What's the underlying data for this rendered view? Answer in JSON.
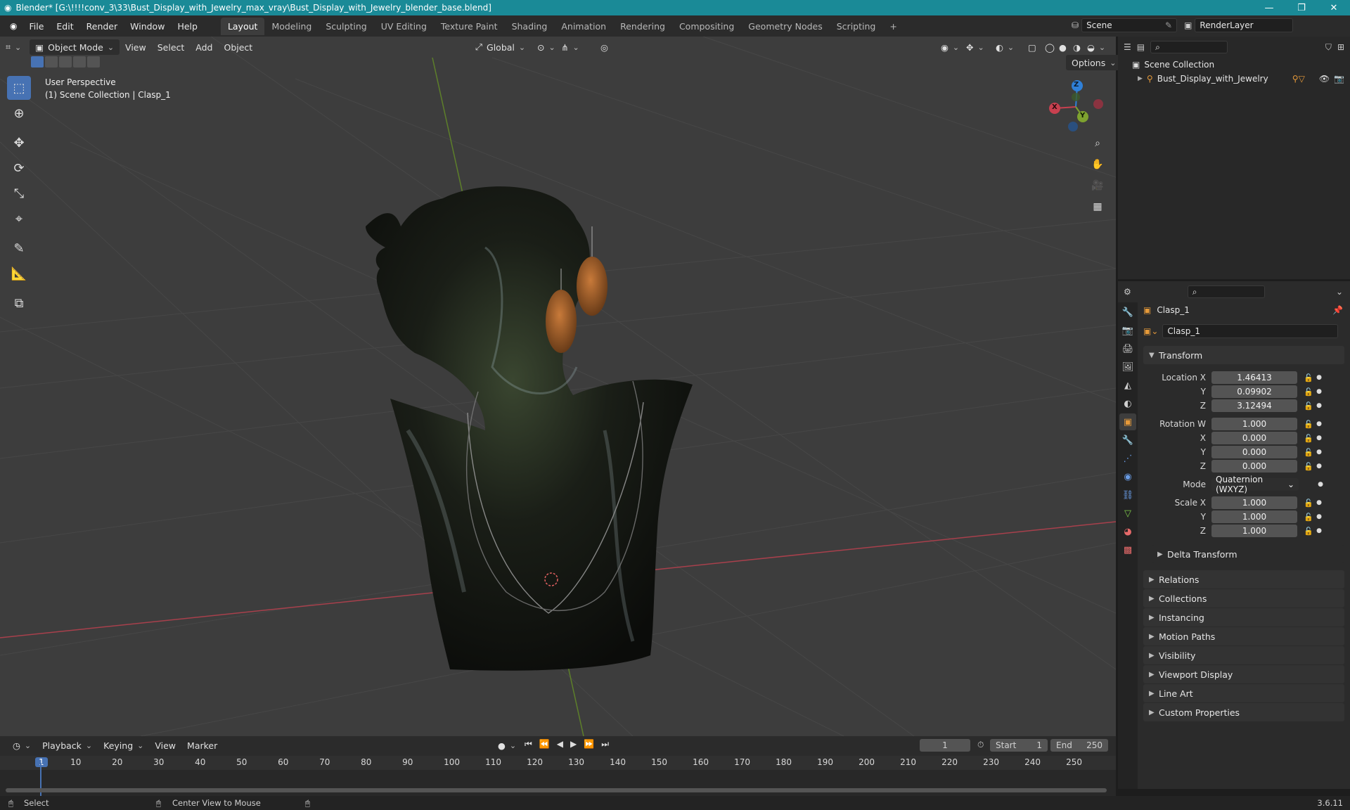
{
  "window": {
    "title": "Blender* [G:\\!!!!conv_3\\33\\Bust_Display_with_Jewelry_max_vray\\Bust_Display_with_Jewelry_blender_base.blend]",
    "minimize": "—",
    "maximize": "❐",
    "close": "✕"
  },
  "menubar": {
    "menus": [
      "File",
      "Edit",
      "Render",
      "Window",
      "Help"
    ],
    "workspaces": [
      "Layout",
      "Modeling",
      "Sculpting",
      "UV Editing",
      "Texture Paint",
      "Shading",
      "Animation",
      "Rendering",
      "Compositing",
      "Geometry Nodes",
      "Scripting"
    ],
    "add_workspace": "+",
    "scene": "Scene",
    "view_layer": "RenderLayer"
  },
  "viewport": {
    "mode": "Object Mode",
    "menus": [
      "View",
      "Select",
      "Add",
      "Object"
    ],
    "transform_orientation": "Global",
    "options": "Options",
    "overlay_title": "User Perspective",
    "overlay_sub": "(1) Scene Collection | Clasp_1",
    "gizmo_axes": {
      "x": "X",
      "y": "Y",
      "z": "Z"
    },
    "colors": {
      "x_axis": "#c8404f",
      "y_axis": "#7ea22f",
      "z_axis": "#2f80d8",
      "grid": "#484848",
      "bg": "#3d3d3d"
    }
  },
  "outliner": {
    "root": "Scene Collection",
    "items": [
      {
        "label": "Bust_Display_with_Jewelry"
      }
    ]
  },
  "properties": {
    "object_name": "Clasp_1",
    "data_name": "Clasp_1",
    "transform_title": "Transform",
    "location": {
      "label_x": "Location X",
      "label_y": "Y",
      "label_z": "Z",
      "x": "1.46413",
      "y": "0.09902",
      "z": "3.12494"
    },
    "rotation": {
      "label_w": "Rotation W",
      "label_x": "X",
      "label_y": "Y",
      "label_z": "Z",
      "w": "1.000",
      "x": "0.000",
      "y": "0.000",
      "z": "0.000"
    },
    "mode_label": "Mode",
    "mode_value": "Quaternion (WXYZ)",
    "scale": {
      "label_x": "Scale X",
      "label_y": "Y",
      "label_z": "Z",
      "x": "1.000",
      "y": "1.000",
      "z": "1.000"
    },
    "delta_transform": "Delta Transform",
    "panels": [
      "Relations",
      "Collections",
      "Instancing",
      "Motion Paths",
      "Visibility",
      "Viewport Display",
      "Line Art",
      "Custom Properties"
    ]
  },
  "timeline": {
    "menus": [
      "Playback",
      "Keying",
      "View",
      "Marker"
    ],
    "current_frame": "1",
    "start_label": "Start",
    "start": "1",
    "end_label": "End",
    "end": "250",
    "ticks": [
      "1",
      "10",
      "20",
      "30",
      "40",
      "50",
      "60",
      "70",
      "80",
      "90",
      "100",
      "110",
      "120",
      "130",
      "140",
      "150",
      "160",
      "170",
      "180",
      "190",
      "200",
      "210",
      "220",
      "230",
      "240",
      "250"
    ]
  },
  "statusbar": {
    "select": "Select",
    "center_view": "Center View to Mouse",
    "version": "3.6.11"
  }
}
